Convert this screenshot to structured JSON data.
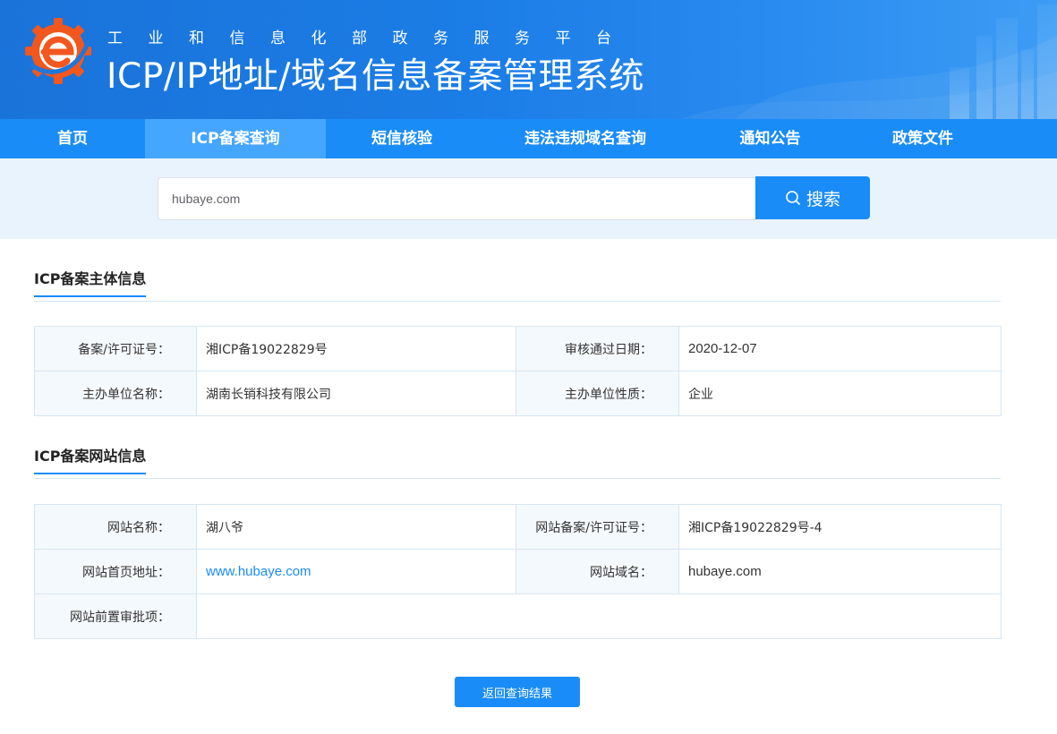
{
  "header": {
    "subtitle": "工业和信息化部政务服务平台",
    "title": "ICP/IP地址/域名信息备案管理系统"
  },
  "nav": [
    {
      "label": "首页",
      "active": false
    },
    {
      "label": "ICP备案查询",
      "active": true
    },
    {
      "label": "短信核验",
      "active": false
    },
    {
      "label": "违法违规域名查询",
      "active": false
    },
    {
      "label": "通知公告",
      "active": false
    },
    {
      "label": "政策文件",
      "active": false
    }
  ],
  "search": {
    "value": "hubaye.com",
    "button_label": "搜索"
  },
  "subject": {
    "title": "ICP备案主体信息",
    "rows": [
      [
        {
          "label": "备案/许可证号：",
          "value": "湘ICP备19022829号"
        },
        {
          "label": "审核通过日期：",
          "value": "2020-12-07"
        }
      ],
      [
        {
          "label": "主办单位名称：",
          "value": "湖南长销科技有限公司"
        },
        {
          "label": "主办单位性质：",
          "value": "企业"
        }
      ]
    ]
  },
  "website": {
    "title": "ICP备案网站信息",
    "name_label": "网站名称：",
    "name_value": "湖八爷",
    "license_label": "网站备案/许可证号：",
    "license_value": "湘ICP备19022829号-4",
    "homepage_label": "网站首页地址：",
    "homepage_value": "www.hubaye.com",
    "domain_label": "网站域名：",
    "domain_value": "hubaye.com",
    "preapproval_label": "网站前置审批项：",
    "preapproval_value": ""
  },
  "back_button": "返回查询结果",
  "colors": {
    "primary": "#1a8cf8",
    "nav_active": "#45a6ff",
    "search_bg": "#e8f3fe",
    "label_bg": "#f4f9fd",
    "border": "#d6e6f3"
  },
  "icons": {
    "logo": "gear-e-logo",
    "search": "search-icon"
  }
}
